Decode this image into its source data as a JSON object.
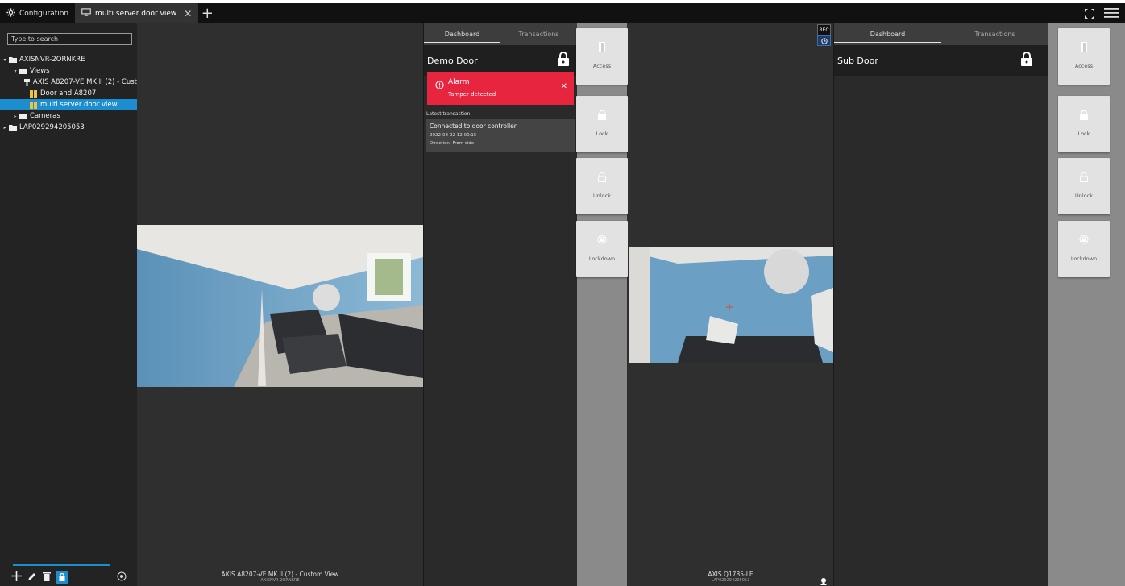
{
  "tabs": [
    {
      "label": "Configuration",
      "icon": "gear-icon",
      "active": false
    },
    {
      "label": "multi server door view",
      "icon": "monitor-icon",
      "active": true,
      "close": "✕"
    }
  ],
  "tab_add": "+",
  "sidebar": {
    "search_placeholder": "Type to search",
    "tree": [
      {
        "label": "AXISNVR-2ORNKRE",
        "icon": "folder-icon",
        "indent": 0,
        "caret": "▾"
      },
      {
        "label": "Views",
        "icon": "folder-icon",
        "indent": 1,
        "caret": "▾"
      },
      {
        "label": "AXIS A8207-VE MK II (2) - Cust",
        "icon": "intercom-icon",
        "indent": 2,
        "caret": ""
      },
      {
        "label": "Door and A8207",
        "icon": "split-view-icon",
        "indent": 2,
        "caret": ""
      },
      {
        "label": "multi server door view",
        "icon": "split-view-icon",
        "indent": 2,
        "caret": "",
        "selected": true
      },
      {
        "label": "Cameras",
        "icon": "folder-icon",
        "indent": 1,
        "caret": "▸"
      },
      {
        "label": "LAP029294205053",
        "icon": "folder-icon",
        "indent": 0,
        "caret": "▸"
      }
    ]
  },
  "left_video": {
    "label": "AXIS A8207-VE MK II (2) - Custom View",
    "sublabel": "AXISNVR-2ORNKRE"
  },
  "right_video": {
    "label": "AXIS Q1785-LE",
    "sublabel": "LAP029294205053",
    "rec": "REC"
  },
  "door1": {
    "tabs": [
      "Dashboard",
      "Transactions"
    ],
    "title": "Demo Door",
    "alarm_title": "Alarm",
    "alarm_sub": "Tamper detected",
    "alarm_close": "✕",
    "latest_label": "Latest transaction",
    "tx_title": "Connected to door controller",
    "tx_time": "2022-08-22 12:00:15",
    "tx_direction": "Direction: From side"
  },
  "door2": {
    "tabs": [
      "Dashboard",
      "Transactions"
    ],
    "title": "Sub Door"
  },
  "actions": [
    "Access",
    "Lock",
    "Unlock",
    "Lockdown"
  ],
  "colors": {
    "accent": "#1c8ed0",
    "alarm": "#e8253f"
  }
}
